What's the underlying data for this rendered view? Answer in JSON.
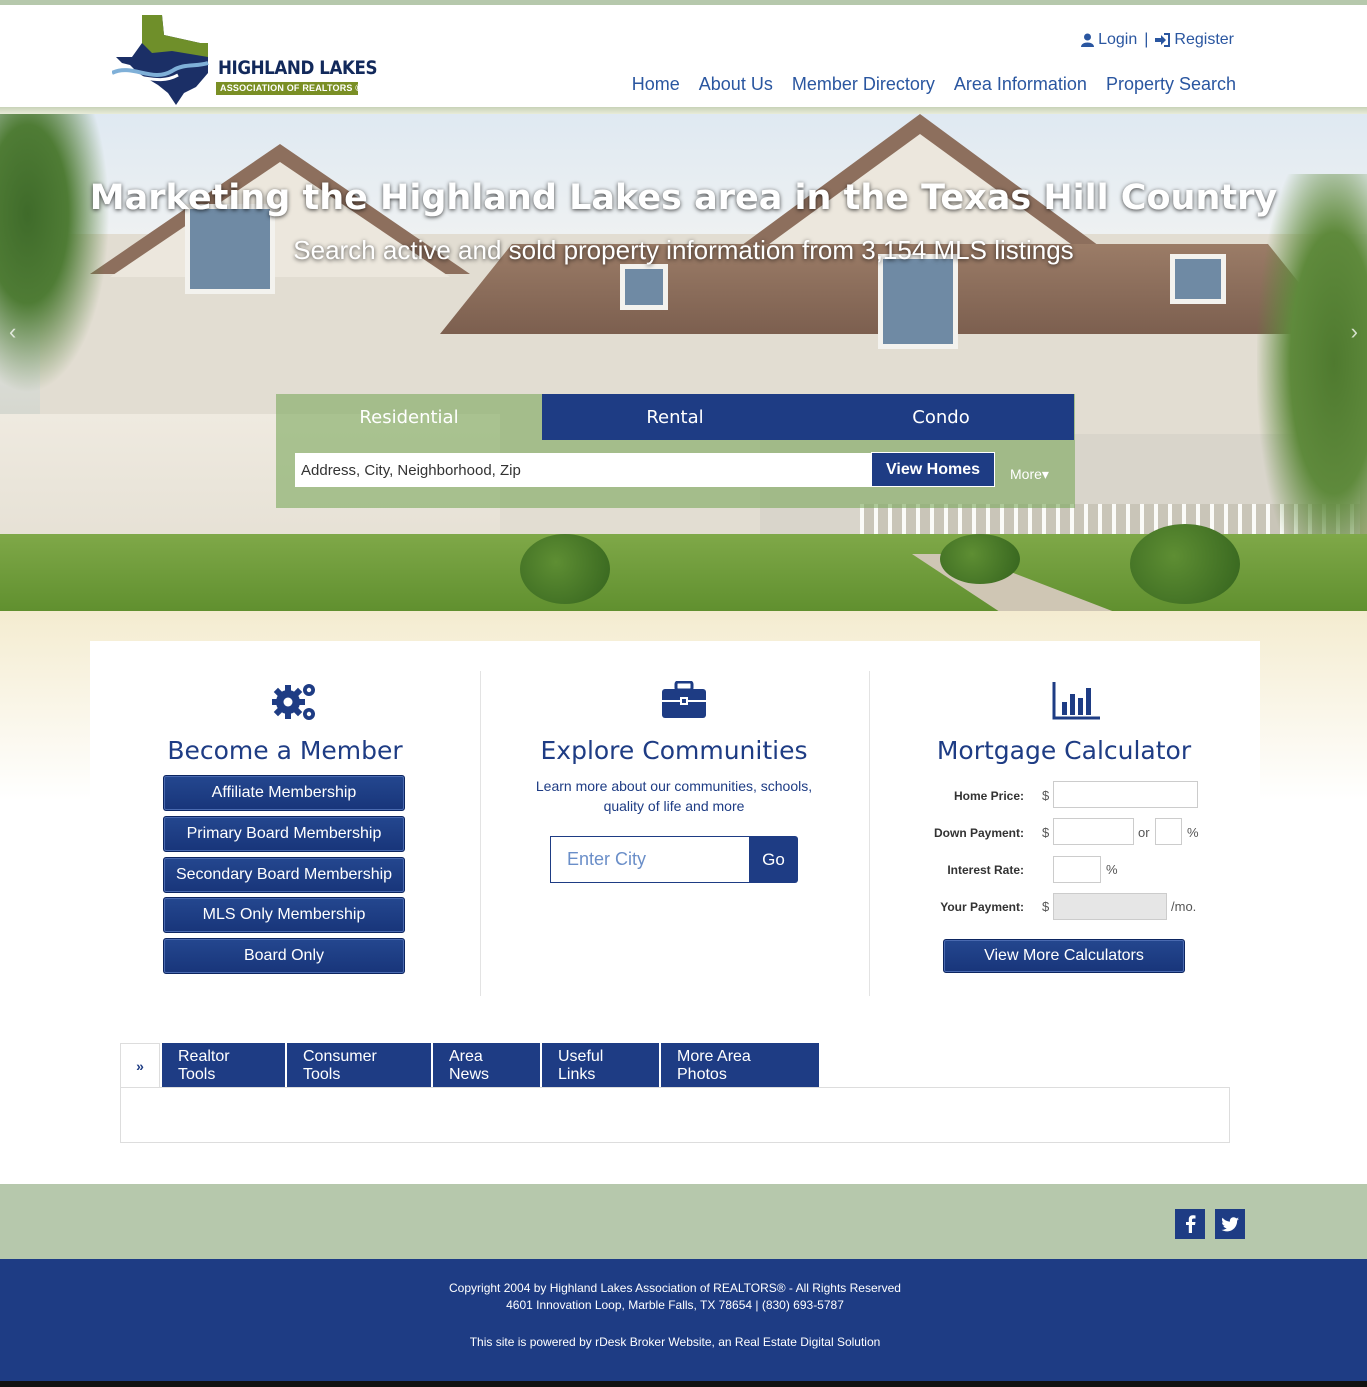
{
  "header": {
    "logo": {
      "title": "HIGHLAND LAKES",
      "subtitle": "ASSOCIATION OF REALTORS ®"
    },
    "auth": {
      "login": "Login",
      "separator": "|",
      "register": "Register"
    },
    "nav": [
      "Home",
      "About Us",
      "Member Directory",
      "Area Information",
      "Property Search"
    ]
  },
  "hero": {
    "title": "Marketing the Highland Lakes area in the Texas Hill Country",
    "subtitle": "Search active and sold property information from 3,154 MLS listings",
    "search": {
      "tabs": [
        "Residential",
        "Rental",
        "Condo"
      ],
      "active_tab": "Residential",
      "placeholder": "Address, City, Neighborhood, Zip",
      "button": "View Homes",
      "more": "More"
    }
  },
  "member": {
    "title": "Become a Member",
    "buttons": [
      "Affiliate Membership",
      "Primary Board Membership",
      "Secondary Board Membership",
      "MLS Only Membership",
      "Board Only"
    ]
  },
  "explore": {
    "title": "Explore Communities",
    "description": "Learn more about our communities, schools, quality of life and more",
    "placeholder": "Enter City",
    "button": "Go"
  },
  "mortgage": {
    "title": "Mortgage Calculator",
    "labels": {
      "home_price": "Home Price:",
      "down_payment": "Down Payment:",
      "interest_rate": "Interest Rate:",
      "your_payment": "Your Payment:"
    },
    "currency": "$",
    "or": "or",
    "percent": "%",
    "per_month": "/mo.",
    "button": "View More Calculators"
  },
  "tabs": {
    "toggle": "»",
    "items": [
      "Realtor Tools",
      "Consumer Tools",
      "Area News",
      "Useful Links",
      "More Area Photos"
    ]
  },
  "footer": {
    "social": [
      "facebook-icon",
      "twitter-icon"
    ],
    "copyright": "Copyright 2004 by Highland Lakes Association of REALTORS® - All Rights Reserved",
    "address": "4601 Innovation Loop, Marble Falls, TX 78654 | (830) 693-5787",
    "powered": "This site is powered by rDesk Broker Website, an Real Estate Digital Solution"
  },
  "colors": {
    "brand_navy": "#1e3c84",
    "link_blue": "#2a56a0",
    "sage": "#b6c8ac",
    "logo_green": "#7a8f25"
  }
}
